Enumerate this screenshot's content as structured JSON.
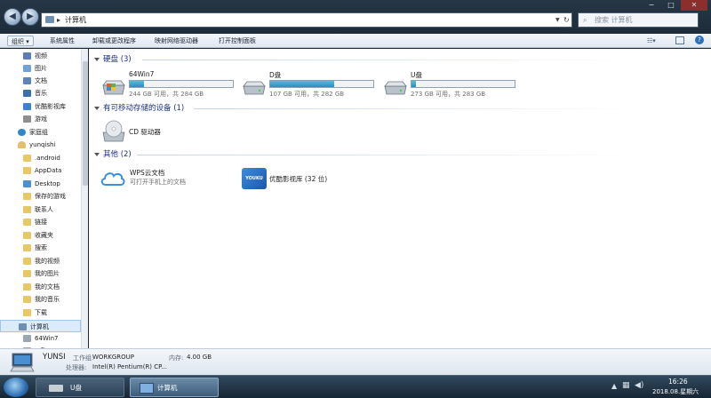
{
  "window": {
    "address": "计算机",
    "search_placeholder": "搜索 计算机",
    "controls": [
      "−",
      "□",
      "✕"
    ]
  },
  "toolbar": {
    "organize": "组织 ▾",
    "items": [
      "系统属性",
      "卸载或更改程序",
      "映射网络驱动器",
      "打开控制面板"
    ]
  },
  "nav": {
    "items": [
      {
        "label": "视频",
        "color": "#5b7fb5"
      },
      {
        "label": "图片",
        "color": "#6fa3d6"
      },
      {
        "label": "文档",
        "color": "#5f84b8"
      },
      {
        "label": "音乐",
        "color": "#3c6ea8"
      },
      {
        "label": "优酷影视库",
        "color": "#3f7fd1"
      },
      {
        "label": "游戏",
        "color": "#8f8f8f"
      },
      {
        "label": "家庭组",
        "color": "#2f86c9"
      },
      {
        "label": "yunqishi",
        "color": "#e2c06e"
      },
      {
        "label": ".android",
        "color": "#e8c766"
      },
      {
        "label": "AppData",
        "color": "#e8c766"
      },
      {
        "label": "Desktop",
        "color": "#4f8fd1"
      },
      {
        "label": "保存的游戏",
        "color": "#e8c766"
      },
      {
        "label": "联系人",
        "color": "#e8c766"
      },
      {
        "label": "链接",
        "color": "#e8c766"
      },
      {
        "label": "收藏夹",
        "color": "#e8c766"
      },
      {
        "label": "搜索",
        "color": "#e8c766"
      },
      {
        "label": "我的视频",
        "color": "#e8c766"
      },
      {
        "label": "我的图片",
        "color": "#e8c766"
      },
      {
        "label": "我的文档",
        "color": "#e8c766"
      },
      {
        "label": "我的音乐",
        "color": "#e8c766"
      },
      {
        "label": "下载",
        "color": "#e8c766"
      },
      {
        "label": "计算机",
        "color": "#6f8fb0"
      },
      {
        "label": "64Win7",
        "color": "#9aa7b3"
      },
      {
        "label": "D盘",
        "color": "#9aa7b3"
      }
    ]
  },
  "groups": {
    "hdd": "硬盘 (3)",
    "removable": "有可移动存储的设备 (1)",
    "other": "其他 (2)"
  },
  "drives": [
    {
      "name": "64Win7",
      "capacity": "244 GB 可用，共 284 GB",
      "used_fraction": 0.14
    },
    {
      "name": "D盘",
      "capacity": "107 GB 可用，共 282 GB",
      "used_fraction": 0.62
    },
    {
      "name": "U盘",
      "capacity": "273 GB 可用，共 283 GB",
      "used_fraction": 0.04
    }
  ],
  "removable": {
    "name": "CD 驱动器"
  },
  "other": [
    {
      "name": "WPS云文档",
      "sub": "可打开手机上的文档"
    },
    {
      "name": "优酷影视库 (32 位)",
      "sub": "",
      "logo": "YOUKU"
    }
  ],
  "details": {
    "computer": "YUNSI",
    "workgroup_label": "工作组:",
    "workgroup": "WORKGROUP",
    "memory_label": "内存:",
    "memory": "4.00 GB",
    "cpu_label": "处理器:",
    "cpu": "Intel(R) Pentium(R) CP..."
  },
  "taskbar": {
    "tasks": [
      "U盘",
      "计算机"
    ],
    "time": "16:26",
    "date": "2018.08.星期六"
  }
}
